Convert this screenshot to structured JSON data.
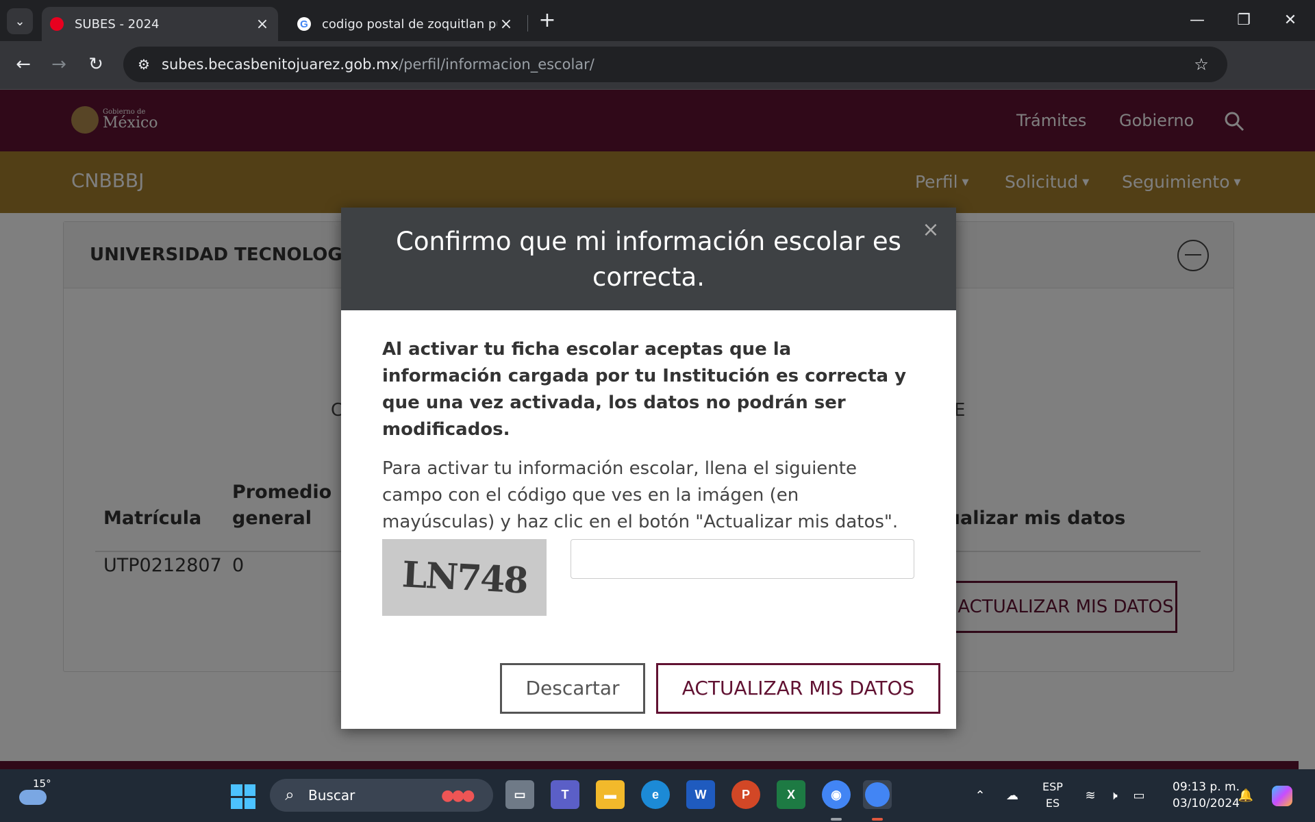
{
  "browser": {
    "tabs": [
      {
        "title": "SUBES - 2024",
        "active": true
      },
      {
        "title": "codigo postal de zoquitlan puebla",
        "active": false
      }
    ],
    "url_domain": "subes.becasbenitojuarez.gob.mx",
    "url_path": "/perfil/informacion_escolar/"
  },
  "gov_header": {
    "logo_small": "Gobierno de",
    "logo_big": "México",
    "nav": [
      "Trámites",
      "Gobierno"
    ]
  },
  "sub_header": {
    "brand": "CNBBBJ",
    "nav": [
      "Perfil",
      "Solicitud",
      "Seguimiento"
    ]
  },
  "card": {
    "title": "UNIVERSIDAD TECNOLOGICA",
    "peek_left": "C",
    "peek_right": "E",
    "columns": {
      "matricula": "Matrícula",
      "promedio": "Promedio general",
      "actualizar": "Actualizar mis datos"
    },
    "row": {
      "matricula": "UTP0212807",
      "promedio": "0"
    },
    "button": "ACTUALIZAR MIS DATOS"
  },
  "modal": {
    "title": "Confirmo que mi información escolar es correcta.",
    "warning": "Al activar tu ficha escolar aceptas que la información cargada por tu Institución es correcta y que una vez activada, los datos no podrán ser modificados.",
    "instructions": "Para activar tu información escolar, llena el siguiente campo con el código que ves en la imágen (en mayúsculas) y haz clic en el botón \"Actualizar mis datos\".",
    "captcha_text": "LN748",
    "input_value": "",
    "discard_label": "Descartar",
    "update_label": "ACTUALIZAR MIS DATOS"
  },
  "taskbar": {
    "weather_temp": "15°",
    "search_label": "Buscar",
    "lang_top": "ESP",
    "lang_bottom": "ES",
    "time": "09:13 p. m.",
    "date": "03/10/2024"
  },
  "colors": {
    "gov_primary": "#611232",
    "gov_gold": "#a57f2c",
    "modal_header": "#3e4144"
  }
}
